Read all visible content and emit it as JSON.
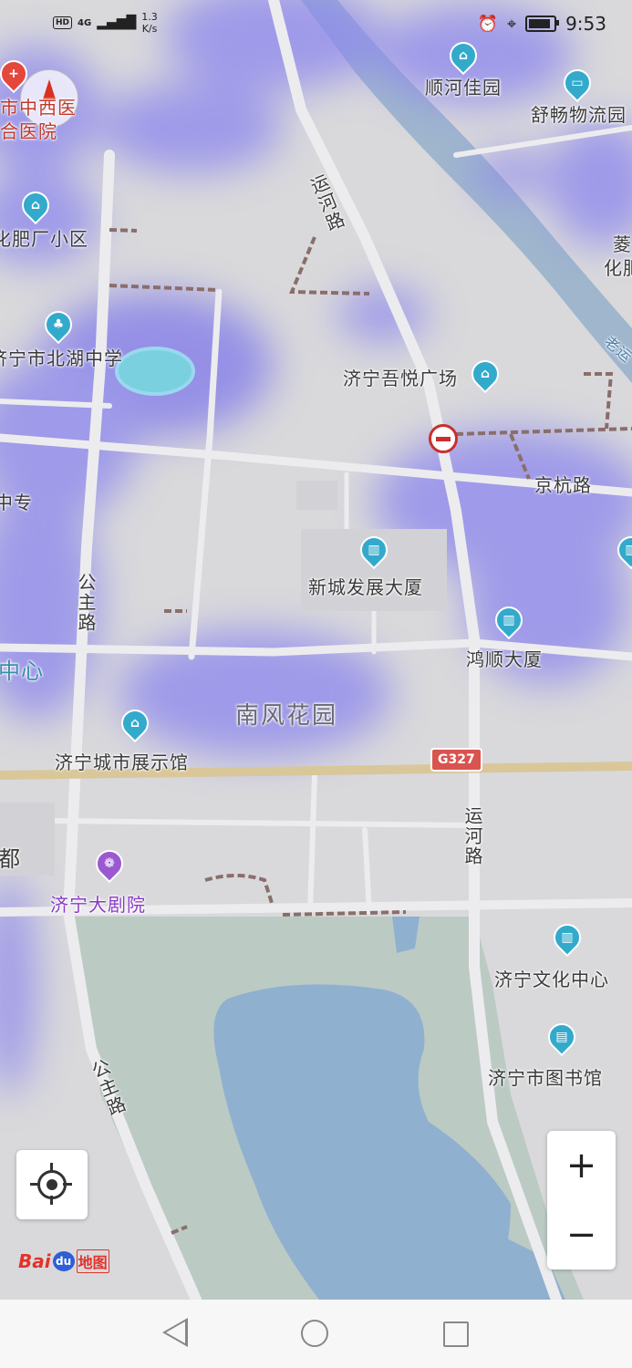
{
  "status_bar": {
    "hd": "HD",
    "network": "4G",
    "speed_value": "1.3",
    "speed_unit": "K/s",
    "time": "9:53",
    "battery_level": 0.9
  },
  "map_labels": {
    "shunhe_jiayuan": "顺河佳园",
    "shuchang_wuliuyuan": "舒畅物流园",
    "zhongxiyi_hospital_1": "市中西医",
    "zhongxiyi_hospital_2": "合医院",
    "feichang_xiaoqu": "化肥厂小区",
    "yunhe_road_top": "运河路",
    "ling_huafei_1": "菱",
    "ling_huafei_2": "化肥",
    "beihu_middle_school": "济宁市北湖中学",
    "wuyue_plaza": "济宁吾悦广场",
    "laoyunhe": "老运",
    "zhongzhuan": "中专",
    "jinghang_road": "京杭路",
    "xincheng_building": "新城发展大厦",
    "gongzhu_road_top": "公主路",
    "zhongxin_left": "中心",
    "hongshun_building": "鸿顺大厦",
    "nanfeng_garden": "南风花园",
    "city_exhibition_hall": "济宁城市展示馆",
    "g327": "G327",
    "yunhe_road_bottom": "运河路",
    "du_left": "都",
    "grand_theatre": "济宁大剧院",
    "culture_center": "济宁文化中心",
    "city_library": "济宁市图书馆",
    "gongzhu_road_bottom": "公主路"
  },
  "controls": {
    "zoom_in": "+",
    "zoom_out": "−"
  },
  "logo": {
    "bai": "Bai",
    "du": "du",
    "ditu": "地图"
  },
  "colors": {
    "map_bg": "#d9d9db",
    "heat": "#8c86ee",
    "water": "#8fb0cf",
    "park": "#bccac4",
    "poi": "#33aacc",
    "theatre": "#9b59d0"
  }
}
